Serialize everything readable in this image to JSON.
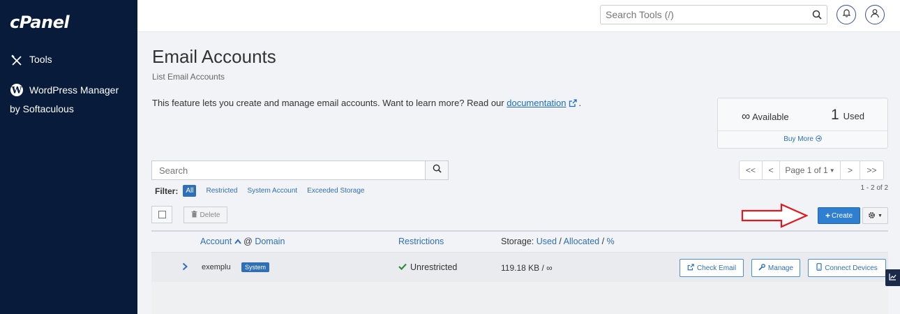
{
  "sidebar": {
    "logo": "cPanel",
    "items": [
      {
        "label": "Tools",
        "icon": "tools-icon"
      },
      {
        "label": "WordPress Manager by Softaculous",
        "icon": "wordpress-icon"
      }
    ]
  },
  "header": {
    "search_placeholder": "Search Tools (/)"
  },
  "page": {
    "title": "Email Accounts",
    "subtitle": "List Email Accounts",
    "intro_text": "This feature lets you create and manage email accounts. Want to learn more? Read our ",
    "intro_link": "documentation",
    "intro_end": "."
  },
  "stats": {
    "available_symbol": "∞",
    "available_label": "Available",
    "used_count": "1",
    "used_label": "Used",
    "buy_more": "Buy More"
  },
  "list": {
    "search_placeholder": "Search",
    "filter_label": "Filter:",
    "filters": [
      "All",
      "Restricted",
      "System Account",
      "Exceeded Storage"
    ],
    "pager": {
      "first": "<<",
      "prev": "<",
      "page": "Page 1 of 1",
      "next": ">",
      "last": ">>"
    },
    "range": "1 - 2 of 2",
    "delete_label": "Delete",
    "create_label": "Create"
  },
  "table": {
    "col_account": "Account",
    "col_at": "@",
    "col_domain": "Domain",
    "col_restrictions": "Restrictions",
    "col_storage_prefix": "Storage:",
    "col_used": "Used",
    "col_allocated": "Allocated",
    "col_percent": "%",
    "rows": [
      {
        "account": "exemplu",
        "badge": "System",
        "restrictions": "Unrestricted",
        "storage": "119.18 KB / ∞",
        "actions": [
          "Check Email",
          "Manage",
          "Connect Devices"
        ]
      }
    ]
  },
  "colors": {
    "sidebar_bg": "#081b3a",
    "accent": "#2e7fd2",
    "link": "#2f6fb5",
    "annotation_arrow": "#e0191f"
  }
}
